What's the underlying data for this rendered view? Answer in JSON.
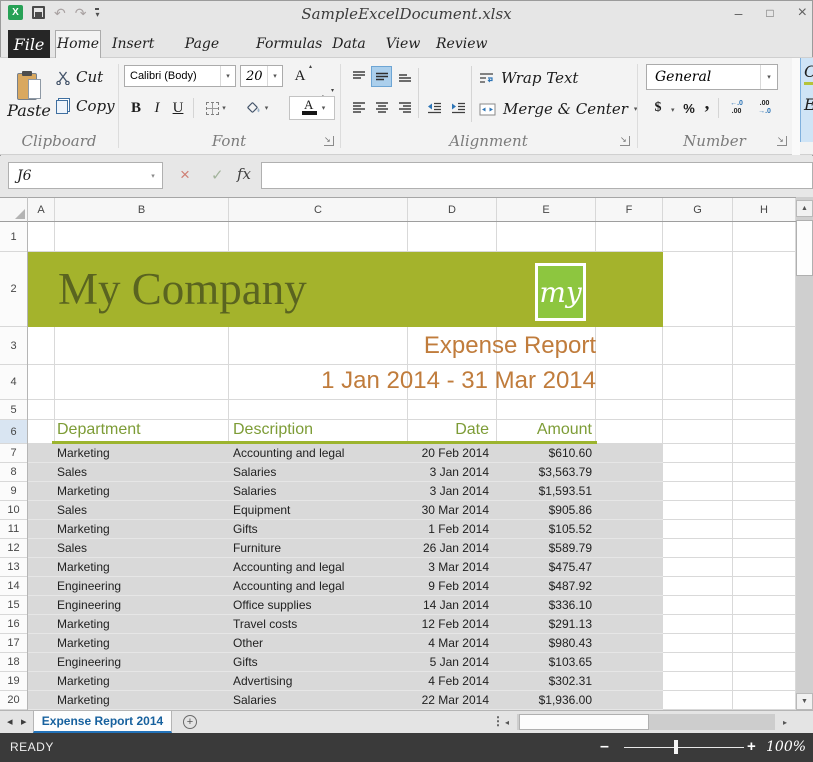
{
  "window": {
    "title": "SampleExcelDocument.xlsx",
    "minimize": "–",
    "maximize": "□",
    "close": "×"
  },
  "quick_access": {
    "app_letter": "X",
    "undo": "↶",
    "redo": "↷",
    "more": "▾"
  },
  "tabs": {
    "file": "File",
    "items": [
      "Home",
      "Insert",
      "Page Layout",
      "Formulas",
      "Data",
      "View",
      "Review"
    ],
    "active": "Home"
  },
  "ribbon": {
    "clipboard": {
      "label": "Clipboard",
      "paste": "Paste",
      "cut": "Cut",
      "copy": "Copy"
    },
    "font": {
      "label": "Font",
      "name": "Calibri (Body)",
      "size": "20",
      "bold": "B",
      "italic": "I",
      "underline": "U",
      "grow": "A",
      "shrink": "A",
      "color_letter": "A",
      "grow_caret": "▴",
      "shrink_caret": "▾"
    },
    "alignment": {
      "label": "Alignment",
      "wrap_text": "Wrap Text",
      "merge_center": "Merge & Center"
    },
    "number": {
      "label": "Number",
      "format": "General",
      "currency": "$",
      "percent": "%",
      "comma": ",",
      "inc_dec_top": "←.0",
      "inc_dec_bot": ".00",
      "dec_dec_top": ".00",
      "dec_dec_bot": "→.0"
    },
    "cutoff": {
      "line1": "C",
      "line2": "E"
    },
    "dropdown_glyph": "▾",
    "launcher_glyph": "↘"
  },
  "formula_bar": {
    "name_box": "J6",
    "cancel": "×",
    "confirm": "✓",
    "fx": "fx",
    "value": ""
  },
  "grid": {
    "columns": [
      "A",
      "B",
      "C",
      "D",
      "E",
      "F",
      "G",
      "H"
    ],
    "rows": [
      "1",
      "2",
      "3",
      "4",
      "5",
      "6",
      "7",
      "8",
      "9",
      "10",
      "11",
      "12",
      "13",
      "14",
      "15",
      "16",
      "17",
      "18",
      "19",
      "20"
    ],
    "active_row": "6",
    "banner": {
      "company": "My Company",
      "logo": "my"
    },
    "report": {
      "title": "Expense Report",
      "period": "1 Jan 2014 - 31 Mar 2014"
    },
    "table": {
      "headers": [
        "Department",
        "Description",
        "Date",
        "Amount"
      ],
      "rows": [
        [
          "Marketing",
          "Accounting and legal",
          "20 Feb 2014",
          "$610.60"
        ],
        [
          "Sales",
          "Salaries",
          "3 Jan 2014",
          "$3,563.79"
        ],
        [
          "Marketing",
          "Salaries",
          "3 Jan 2014",
          "$1,593.51"
        ],
        [
          "Sales",
          "Equipment",
          "30 Mar 2014",
          "$905.86"
        ],
        [
          "Marketing",
          "Gifts",
          "1 Feb 2014",
          "$105.52"
        ],
        [
          "Sales",
          "Furniture",
          "26 Jan 2014",
          "$589.79"
        ],
        [
          "Marketing",
          "Accounting and legal",
          "3 Mar 2014",
          "$475.47"
        ],
        [
          "Engineering",
          "Accounting and legal",
          "9 Feb 2014",
          "$487.92"
        ],
        [
          "Engineering",
          "Office supplies",
          "14 Jan 2014",
          "$336.10"
        ],
        [
          "Marketing",
          "Travel costs",
          "12 Feb 2014",
          "$291.13"
        ],
        [
          "Marketing",
          "Other",
          "4 Mar 2014",
          "$980.43"
        ],
        [
          "Engineering",
          "Gifts",
          "5 Jan 2014",
          "$103.65"
        ],
        [
          "Marketing",
          "Advertising",
          "4 Feb 2014",
          "$302.31"
        ],
        [
          "Marketing",
          "Salaries",
          "22 Mar 2014",
          "$1,936.00"
        ]
      ]
    }
  },
  "sheet_tabs": {
    "active": "Expense Report 2014",
    "nav_left": "◂",
    "nav_right": "▸",
    "new_sheet": "+",
    "menu": "⋮"
  },
  "status_bar": {
    "mode": "READY",
    "zoom_out": "–",
    "zoom_in": "+",
    "zoom_level": "100%"
  },
  "colors": {
    "banner_green": "#a4b32c",
    "logo_green": "#8dc63f",
    "company_text": "#5a6420",
    "report_accent": "#c07c3c",
    "table_header_text": "#7d9c36",
    "header_underline": "#9cb42e",
    "table_bg": "#d9d9d9",
    "active_tab_blue": "#17619e",
    "selection_blue": "#abcfec",
    "status_bar_bg": "#3a3a3a"
  }
}
